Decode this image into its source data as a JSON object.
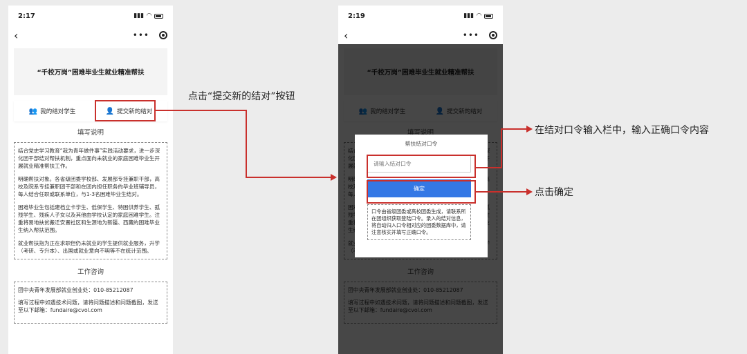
{
  "left_phone": {
    "time": "2:17",
    "banner_title": "“千校万岗”困难毕业生就业精准帮扶",
    "tab_my_students": "我的结对学生",
    "tab_submit_new": "提交新的结对",
    "section_instructions": "填写说明",
    "instructions": [
      "结合党史学习教育“我为青年做件事”实践活动要求，进一步深化团干部结对帮扶机制，重点面向未就业的家庭困难毕业生开展就业精准帮扶工作。",
      "明确帮扶对象。各省级团委学校部、发展部专挂兼职干部，高校及院系专挂兼职团干部和在团内担任职务的毕业班辅导员，每人结合任职或联系单位，与1-3名困难毕业生结对。",
      "困难毕业生包括建档立卡学生、低保学生、特困供养学生、孤残学生、残疾人子女以及其他由学校认定的家庭困难学生。注重将易地扶贫搬迁安置社区和生源地为新疆、西藏的困难毕业生纳入帮扶范围。",
      "就业帮扶指为正在求职但仍未就业的学生提供就业服务，升学（考研、专升本）、出国或就业意向不明等不在统计范围。"
    ],
    "section_consult": "工作咨询",
    "consult_phone": "团中央青年发展部就业创业处：010-85212087",
    "consult_note": "填写过程中如遇技术问题，请将问题描述和问题截图，发送至以下邮箱：fundaire@cvol.com"
  },
  "right_phone": {
    "time": "2:19",
    "modal_title": "帮扶结对口令",
    "code_placeholder": "请输入结对口令",
    "confirm_label": "确定",
    "modal_note": "口令由省级团委或高校团委生成，请联系所在团组织获取登陆口令。录入的结对信息，将自动归入口令相对应的团委数据库中，请注意核实并填写正确口令。"
  },
  "annotations": {
    "submit_new": "点击“提交新的结对”按钮",
    "enter_code": "在结对口令输入栏中，输入正确口令内容",
    "click_confirm": "点击确定"
  },
  "colors": {
    "highlight": "#c9302c",
    "confirm_button": "#3478e5"
  }
}
